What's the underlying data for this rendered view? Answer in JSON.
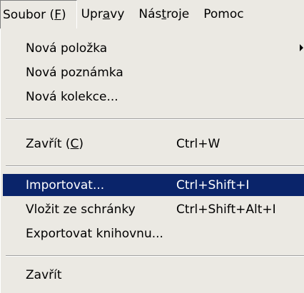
{
  "menubar": {
    "items": [
      {
        "pre": "Soubor (",
        "mn": "F",
        "post": ")"
      },
      {
        "pre": "Upr",
        "mn": "a",
        "post": "vy"
      },
      {
        "pre": "Nás",
        "mn": "t",
        "post": "roje"
      },
      {
        "pre": "Pomoc",
        "mn": "",
        "post": ""
      }
    ]
  },
  "menu": {
    "new_item": "Nová položka",
    "new_note": "Nová poznámka",
    "new_collection": "Nová kolekce...",
    "close_tab": {
      "pre": "Zavřít (",
      "mn": "C",
      "post": ")",
      "shortcut": "Ctrl+W"
    },
    "import": {
      "label": "Importovat...",
      "shortcut": "Ctrl+Shift+I"
    },
    "paste": {
      "label": "Vložit ze schránky",
      "shortcut": "Ctrl+Shift+Alt+I"
    },
    "export": "Exportovat knihovnu...",
    "quit": "Zavřít"
  }
}
